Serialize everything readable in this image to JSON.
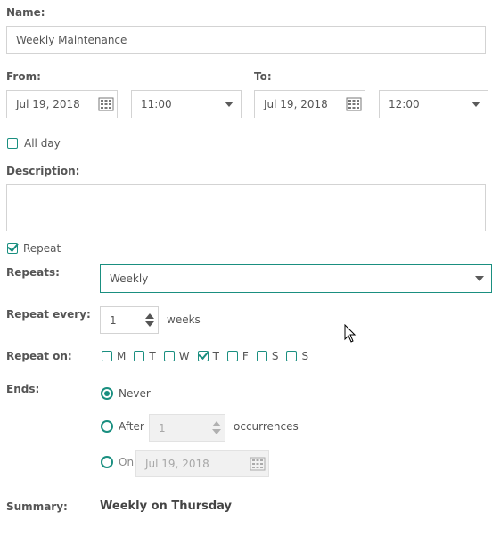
{
  "labels": {
    "name": "Name:",
    "from": "From:",
    "to": "To:",
    "description": "Description:",
    "repeats": "Repeats:",
    "repeat_every": "Repeat every:",
    "repeat_on": "Repeat on:",
    "ends": "Ends:",
    "summary": "Summary:"
  },
  "name_value": "Weekly Maintenance",
  "from": {
    "date": "Jul 19, 2018",
    "time": "11:00"
  },
  "to": {
    "date": "Jul 19, 2018",
    "time": "12:00"
  },
  "all_day": {
    "label": "All day",
    "checked": false
  },
  "description_value": "",
  "repeat": {
    "label": "Repeat",
    "checked": true
  },
  "repeats_value": "Weekly",
  "repeat_every": {
    "value": "1",
    "unit": "weeks"
  },
  "repeat_on": [
    {
      "label": "M",
      "checked": false
    },
    {
      "label": "T",
      "checked": false
    },
    {
      "label": "W",
      "checked": false
    },
    {
      "label": "T",
      "checked": true
    },
    {
      "label": "F",
      "checked": false
    },
    {
      "label": "S",
      "checked": false
    },
    {
      "label": "S",
      "checked": false
    }
  ],
  "ends": {
    "never_label": "Never",
    "after_label": "After",
    "after_value": "1",
    "after_unit": "occurrences",
    "on_label": "On",
    "on_date": "Jul 19, 2018",
    "selected": "never"
  },
  "summary_value": "Weekly on Thursday",
  "colors": {
    "accent": "#1a8f80",
    "border": "#d3d3d3",
    "disabled_bg": "#f1f1f1"
  },
  "icons": {
    "calendar": "calendar-icon",
    "dropdown": "chevron-down-icon",
    "cursor": "mouse-cursor-icon"
  }
}
